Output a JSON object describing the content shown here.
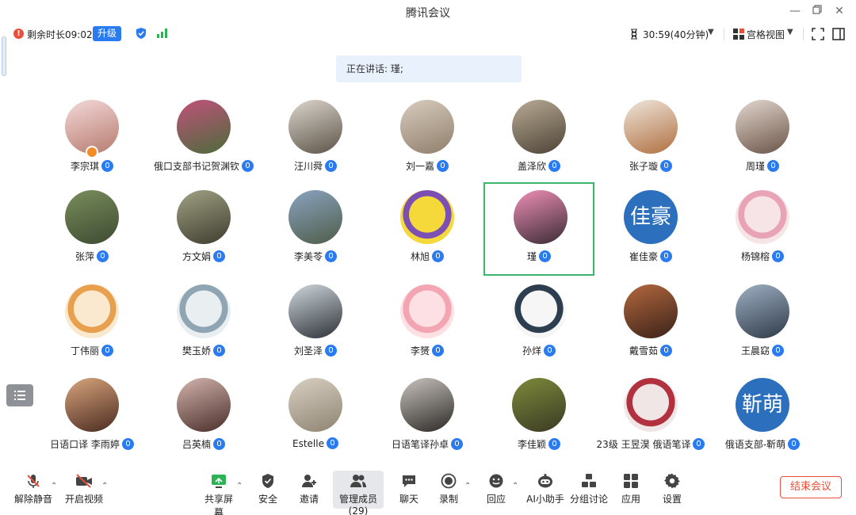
{
  "window": {
    "title": "腾讯会议"
  },
  "status": {
    "remaining": "剩余时长09:02",
    "upgrade": "升级",
    "timer": "30:59(40分钟)",
    "view_mode": "宫格视图"
  },
  "speaking": "正在讲话: 瑾;",
  "participants": [
    {
      "name": "李宗琪",
      "avatar": "photo",
      "colors": [
        "#f4d9d9",
        "#b67b6e"
      ],
      "host": true
    },
    {
      "name": "俄口支部书记贺渊钦",
      "avatar": "photo",
      "colors": [
        "#c1527a",
        "#4c6b3b"
      ]
    },
    {
      "name": "汪川舜",
      "avatar": "photo",
      "colors": [
        "#dcd6cc",
        "#5d5449"
      ]
    },
    {
      "name": "刘一嘉",
      "avatar": "photo",
      "colors": [
        "#d9cdbf",
        "#8f7e6b"
      ]
    },
    {
      "name": "盖泽欣",
      "avatar": "photo",
      "colors": [
        "#b9ab94",
        "#4d4337"
      ]
    },
    {
      "name": "张子璇",
      "avatar": "photo",
      "colors": [
        "#efe6dc",
        "#b07040"
      ]
    },
    {
      "name": "周瑾",
      "avatar": "photo",
      "colors": [
        "#e4d8cf",
        "#6b5448"
      ]
    },
    {
      "name": "张萍",
      "avatar": "photo",
      "colors": [
        "#7a8e5c",
        "#3d4a31"
      ]
    },
    {
      "name": "方文娟",
      "avatar": "photo",
      "colors": [
        "#a0a283",
        "#3f3d30"
      ]
    },
    {
      "name": "李美苓",
      "avatar": "photo",
      "colors": [
        "#8aa3bf",
        "#4f5d4a"
      ]
    },
    {
      "name": "林旭",
      "avatar": "cartoon",
      "colors": [
        "#f5d83a",
        "#7b4fb3"
      ]
    },
    {
      "name": "瑾",
      "avatar": "photo",
      "colors": [
        "#ef8fb7",
        "#3a2b34"
      ],
      "active": true
    },
    {
      "name": "崔佳豪",
      "avatar": "text",
      "text": "佳豪"
    },
    {
      "name": "杨锦榕",
      "avatar": "cartoon",
      "colors": [
        "#f6e4e6",
        "#e9a3b6"
      ]
    },
    {
      "name": "丁伟丽",
      "avatar": "cartoon",
      "colors": [
        "#fbe9cf",
        "#e8a04e"
      ]
    },
    {
      "name": "樊玉娇",
      "avatar": "cartoon",
      "colors": [
        "#e9eef1",
        "#8fa5b3"
      ]
    },
    {
      "name": "刘圣泽",
      "avatar": "photo",
      "colors": [
        "#cfd7dd",
        "#2d3238"
      ]
    },
    {
      "name": "李赟",
      "avatar": "cartoon",
      "colors": [
        "#fde0e4",
        "#f4a5b2"
      ]
    },
    {
      "name": "孙烊",
      "avatar": "cartoon",
      "colors": [
        "#f6f6f6",
        "#2c3e50"
      ]
    },
    {
      "name": "戴雪茹",
      "avatar": "photo",
      "colors": [
        "#b4683e",
        "#3a2219"
      ]
    },
    {
      "name": "王晨窈",
      "avatar": "photo",
      "colors": [
        "#9fb0c4",
        "#2e3a48"
      ]
    },
    {
      "name": "日语口译 李雨婷",
      "avatar": "photo",
      "colors": [
        "#d9a57d",
        "#4a2b20"
      ]
    },
    {
      "name": "吕英楠",
      "avatar": "photo",
      "colors": [
        "#d3b4ad",
        "#4a2e2a"
      ]
    },
    {
      "name": "Estelle",
      "avatar": "photo",
      "colors": [
        "#d8d0c2",
        "#8f8473"
      ]
    },
    {
      "name": "日语笔译孙卓",
      "avatar": "photo",
      "colors": [
        "#c8c3bd",
        "#2d2a27"
      ]
    },
    {
      "name": "李佳颖",
      "avatar": "photo",
      "colors": [
        "#7e8a3a",
        "#3a3a24"
      ]
    },
    {
      "name": "23级 王昱淏 俄语笔译",
      "avatar": "cartoon",
      "colors": [
        "#f1e6e6",
        "#b2313e"
      ]
    },
    {
      "name": "俄语支部-靳萌",
      "avatar": "text",
      "text": "靳萌"
    }
  ],
  "toolbar": {
    "unmute": "解除静音",
    "start_video": "开启视频",
    "share": "共享屏幕",
    "security": "安全",
    "invite": "邀请",
    "members": "管理成员(29)",
    "chat": "聊天",
    "record": "录制",
    "react": "回应",
    "ai": "AI小助手",
    "breakout": "分组讨论",
    "apps": "应用",
    "settings": "设置",
    "end": "结束会议"
  },
  "colors": {
    "accent": "#2a7bf0",
    "end": "#e8503a",
    "active_border": "#3bb56b",
    "banner": "#e9f1fd"
  }
}
